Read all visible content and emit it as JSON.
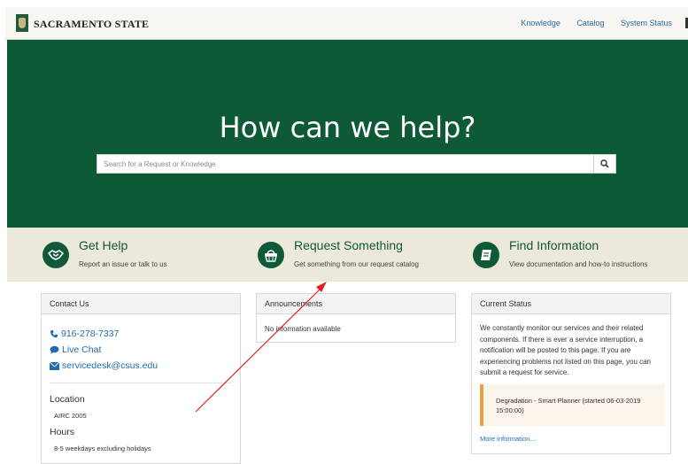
{
  "header": {
    "logo_text": "SACRAMENTO STATE",
    "nav": [
      "Knowledge",
      "Catalog",
      "System Status"
    ]
  },
  "hero": {
    "title": "How can we help?",
    "search_placeholder": "Search for a Request or Knowledge",
    "search_icon": "search-icon"
  },
  "actions": [
    {
      "title": "Get Help",
      "subtitle": "Report an issue or talk to us",
      "icon": "handshake-icon"
    },
    {
      "title": "Request Something",
      "subtitle": "Get something from our request catalog",
      "icon": "basket-icon"
    },
    {
      "title": "Find Information",
      "subtitle": "View documentation and how-to instructions",
      "icon": "book-icon"
    }
  ],
  "contact": {
    "heading": "Contact Us",
    "phone": "916-278-7337",
    "chat": "Live Chat",
    "email": "servicedesk@csus.edu",
    "location_label": "Location",
    "location_value": "AIRC 2005",
    "hours_label": "Hours",
    "hours_value": "8-5 weekdays excluding holidays"
  },
  "announcements": {
    "heading": "Announcements",
    "empty_text": "No information available"
  },
  "status": {
    "heading": "Current Status",
    "body": "We constantly monitor our services and their related components. If there is ever a service interruption, a notification will be posted to this page. If you are experiencing problems not listed on this page, you can submit a request for service.",
    "alert": "Degradation - Smart Planner (started 06-03-2019 15:00:00)",
    "alert_color": "#e8a33a",
    "more_link": "More information..."
  },
  "colors": {
    "brand_green": "#0e5a37",
    "strip_bg": "#ece8da",
    "link_blue": "#1d6bb0",
    "annotation_red": "#e02020"
  }
}
